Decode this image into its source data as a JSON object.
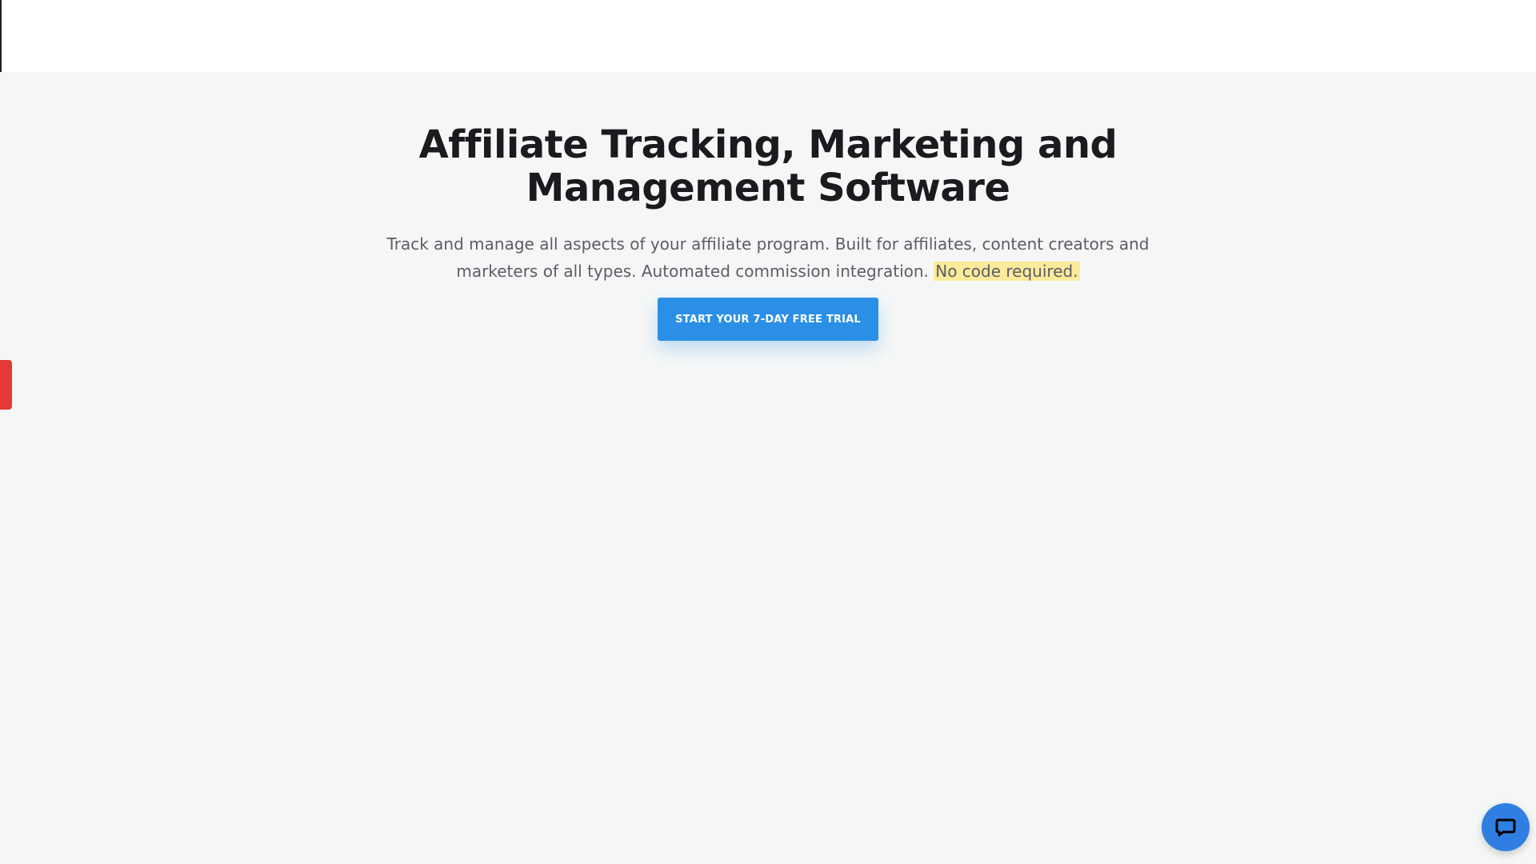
{
  "hero": {
    "title": "Affiliate Tracking, Marketing and Management Software",
    "subtitle_main": "Track and manage all aspects of your affiliate program. Built for affiliates, content creators and marketers of all types. Automated commission integration.",
    "subtitle_highlight": "No code required.",
    "cta_label": "START YOUR 7-DAY FREE TRIAL"
  },
  "colors": {
    "accent": "#2b8fe6",
    "highlight": "#fbeb9a",
    "side_tab": "#e53935",
    "chat": "#2f7fe3"
  },
  "icons": {
    "chat": "chat-bubble-icon"
  }
}
